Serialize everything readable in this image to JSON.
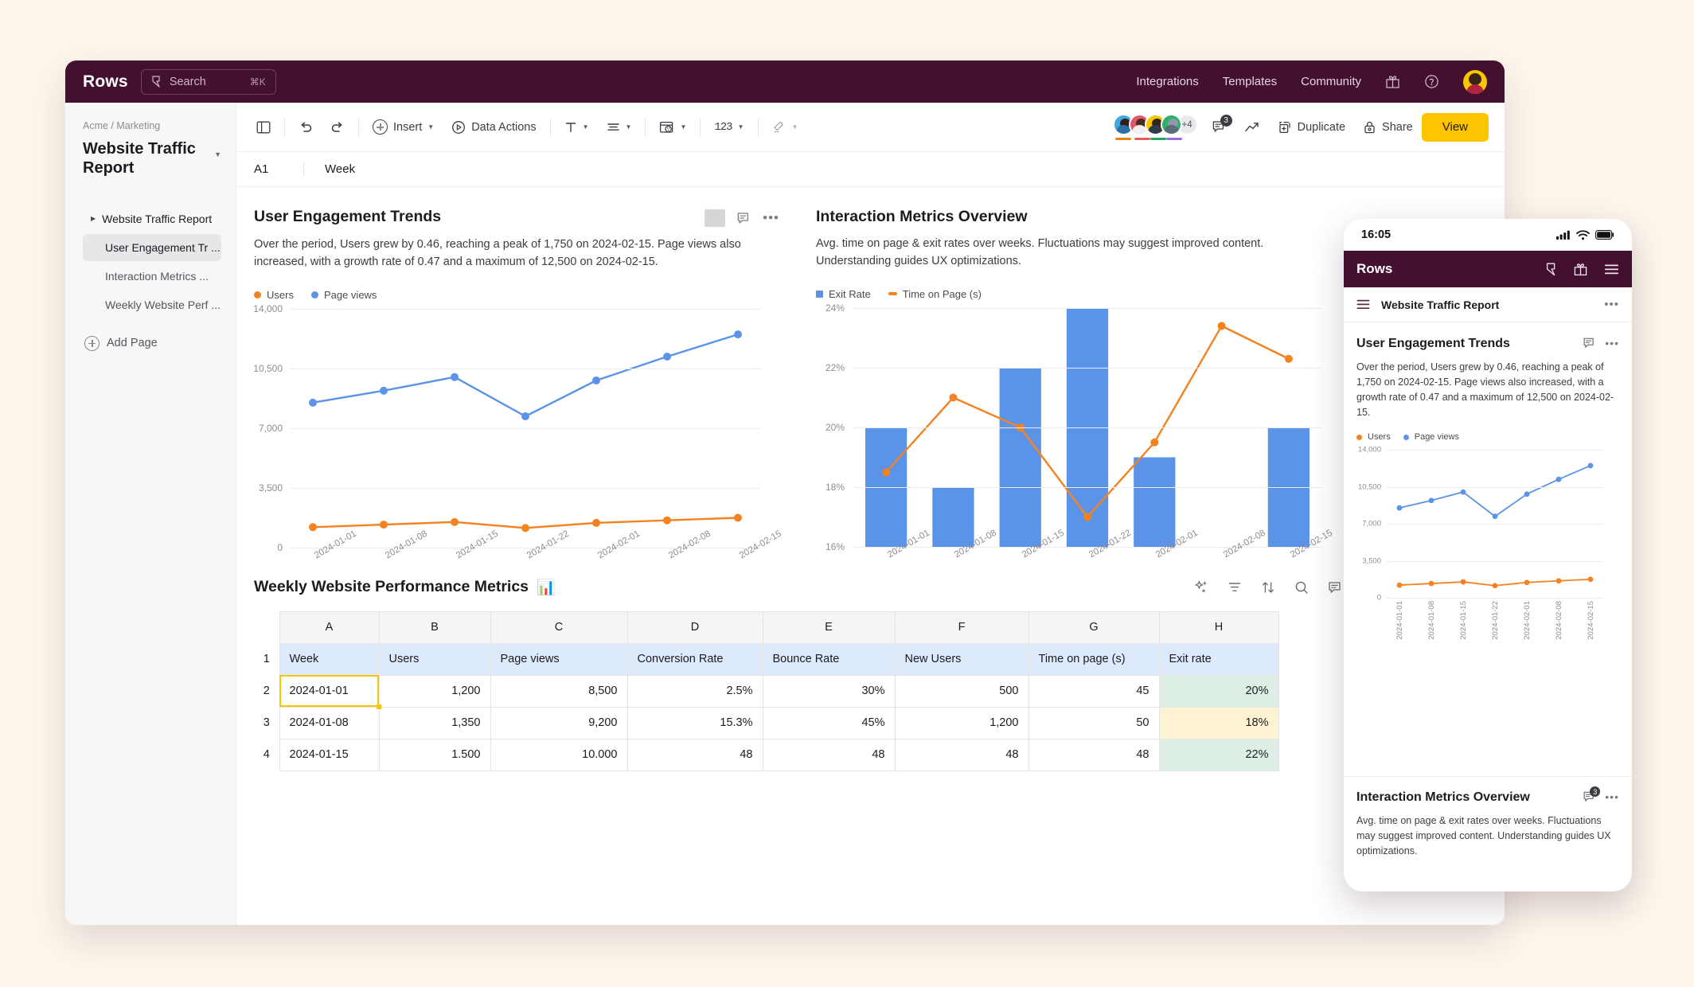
{
  "topbar": {
    "brand": "Rows",
    "search_placeholder": "Search",
    "search_shortcut": "⌘K",
    "nav": [
      {
        "label": "Integrations"
      },
      {
        "label": "Templates"
      },
      {
        "label": "Community"
      }
    ],
    "gift_icon": "gift-icon",
    "help_icon": "help-circle-icon",
    "avatar": "user-avatar"
  },
  "sidebar": {
    "breadcrumb": "Acme / Marketing",
    "doc_title": "Website Traffic Report",
    "items": [
      {
        "label": "Website Traffic Report",
        "state": "root"
      },
      {
        "label": "User Engagement Tr ...",
        "state": "active"
      },
      {
        "label": "Interaction Metrics ...",
        "state": "normal"
      },
      {
        "label": "Weekly Website Perf ...",
        "state": "normal"
      }
    ],
    "add_page": "Add Page"
  },
  "toolbar": {
    "panel_icon": "sidebar-toggle-icon",
    "undo_icon": "undo-icon",
    "redo_icon": "redo-icon",
    "insert_label": "Insert",
    "data_actions_label": "Data Actions",
    "text_format_icon": "text-format-icon",
    "align_icon": "align-icon",
    "fill_icon": "fill-color-icon",
    "number_format_icon": "number-format-icon",
    "eraser_icon": "clear-format-icon",
    "collaborators_overflow": "+4",
    "comment_count": "3",
    "trend_icon": "trend-up-icon",
    "duplicate_label": "Duplicate",
    "share_label": "Share",
    "view_label": "View"
  },
  "formula_bar": {
    "cell_ref": "A1",
    "value": "Week"
  },
  "colors": {
    "brand_plum": "#43102f",
    "accent_yellow": "#fdc500",
    "series_users": "#f58220",
    "series_pageviews": "#5b93e8",
    "header_blue_bg": "#ddeafb",
    "header_blue_text": "#12376b"
  },
  "cards": [
    {
      "title": "User Engagement Trends",
      "description": "Over the period, Users grew by 0.46, reaching a peak of 1,750 on 2024-02-15. Page views also increased, with a growth rate of 0.47 and a maximum of 12,500 on 2024-02-15.",
      "comment_icon": "comment-icon",
      "more_icon": "more-options-icon"
    },
    {
      "title": "Interaction Metrics Overview",
      "description": "Avg. time on page & exit rates over weeks. Fluctuations may suggest improved content. Understanding guides UX optimizations.",
      "comment_icon": "comment-icon",
      "more_icon": "more-options-icon"
    }
  ],
  "chart_data": [
    {
      "type": "line",
      "title": "User Engagement Trends",
      "xlabel": "",
      "ylabel": "",
      "grid": true,
      "legend_position": "top-left",
      "categories": [
        "2024-01-01",
        "2024-01-08",
        "2024-01-15",
        "2024-01-22",
        "2024-02-01",
        "2024-02-08",
        "2024-02-15"
      ],
      "yticks": [
        "0",
        "3,500",
        "7,000",
        "10,500",
        "14,000"
      ],
      "ylim": [
        0,
        14000
      ],
      "series": [
        {
          "name": "Users",
          "color": "#f58220",
          "values": [
            1200,
            1350,
            1500,
            1150,
            1450,
            1600,
            1750
          ]
        },
        {
          "name": "Page views",
          "color": "#5b93e8",
          "values": [
            8500,
            9200,
            10000,
            7700,
            9800,
            11200,
            12500
          ]
        }
      ]
    },
    {
      "type": "bar",
      "title": "Interaction Metrics Overview",
      "xlabel": "",
      "ylabel": "",
      "grid": true,
      "legend_position": "top-left",
      "categories": [
        "2024-01-01",
        "2024-01-08",
        "2024-01-15",
        "2024-01-22",
        "2024-02-01",
        "2024-02-08",
        "2024-02-15"
      ],
      "yticks": [
        "16%",
        "18%",
        "20%",
        "22%",
        "24%"
      ],
      "ylim": [
        16,
        24
      ],
      "series": [
        {
          "name": "Exit Rate",
          "color": "#5b93e8",
          "type": "bar",
          "values": [
            20,
            18,
            22,
            24,
            19,
            null,
            20
          ]
        },
        {
          "name": "Time on Page (s)",
          "color": "#f58220",
          "type": "line",
          "values": [
            18.5,
            21.0,
            20.0,
            17.0,
            19.5,
            23.4,
            22.3
          ]
        }
      ]
    }
  ],
  "sheet": {
    "title": "Weekly Website Performance Metrics",
    "emoji": "📊",
    "tools": [
      "ai-sparkle-icon",
      "filter-icon",
      "sort-icon",
      "search-icon",
      "comment-icon",
      "more-options-icon"
    ],
    "column_letters": [
      "A",
      "B",
      "C",
      "D",
      "E",
      "F",
      "G",
      "H"
    ],
    "row_numbers": [
      "1",
      "2",
      "3",
      "4"
    ],
    "headers": [
      "Week",
      "Users",
      "Page views",
      "Conversion Rate",
      "Bounce Rate",
      "New Users",
      "Time on page (s)",
      "Exit rate"
    ],
    "rows": [
      {
        "cells": [
          "2024-01-01",
          "1,200",
          "8,500",
          "2.5%",
          "30%",
          "500",
          "45",
          "20%"
        ],
        "exit_style": "green"
      },
      {
        "cells": [
          "2024-01-08",
          "1,350",
          "9,200",
          "15.3%",
          "45%",
          "1,200",
          "50",
          "18%"
        ],
        "exit_style": "yellow"
      },
      {
        "cells": [
          "2024-01-15",
          "1.500",
          "10.000",
          "48",
          "48",
          "48",
          "48",
          "22%"
        ],
        "exit_style": "green2"
      }
    ],
    "selected_cell": "2024-01-01"
  },
  "phone": {
    "status_time": "16:05",
    "signal_icon": "cellular-signal-icon",
    "wifi_icon": "wifi-icon",
    "battery_icon": "battery-icon",
    "brand": "Rows",
    "bolt_icon": "bolt-icon",
    "gift_icon": "gift-icon",
    "menu_icon": "hamburger-menu-icon",
    "doc_menu_icon": "doc-menu-icon",
    "doc_title": "Website Traffic Report",
    "doc_more_icon": "more-options-icon",
    "sections": [
      {
        "title": "User Engagement Trends",
        "description": "Over the period, Users grew by 0.46, reaching a peak of 1,750 on 2024-02-15. Page views also increased, with a growth rate of 0.47 and a maximum of 12,500 on 2024-02-15.",
        "comment_icon": "comment-icon",
        "more_icon": "more-options-icon"
      },
      {
        "title": "Interaction Metrics Overview",
        "description": "Avg. time on page & exit rates over weeks. Fluctuations may suggest improved content. Understanding guides UX optimizations.",
        "comment_icon": "comment-icon",
        "comment_count": "3",
        "more_icon": "more-options-icon"
      }
    ],
    "chart_legend": [
      {
        "label": "Users",
        "color": "#f58220"
      },
      {
        "label": "Page views",
        "color": "#5b93e8"
      }
    ],
    "chart_yticks": [
      "0",
      "3,500",
      "7,000",
      "10,500",
      "14,000"
    ],
    "chart_xlabels": [
      "2024-01-01",
      "2024-01-08",
      "2024-01-15",
      "2024-01-22",
      "2024-02-01",
      "2024-02-08",
      "2024-02-15"
    ]
  }
}
